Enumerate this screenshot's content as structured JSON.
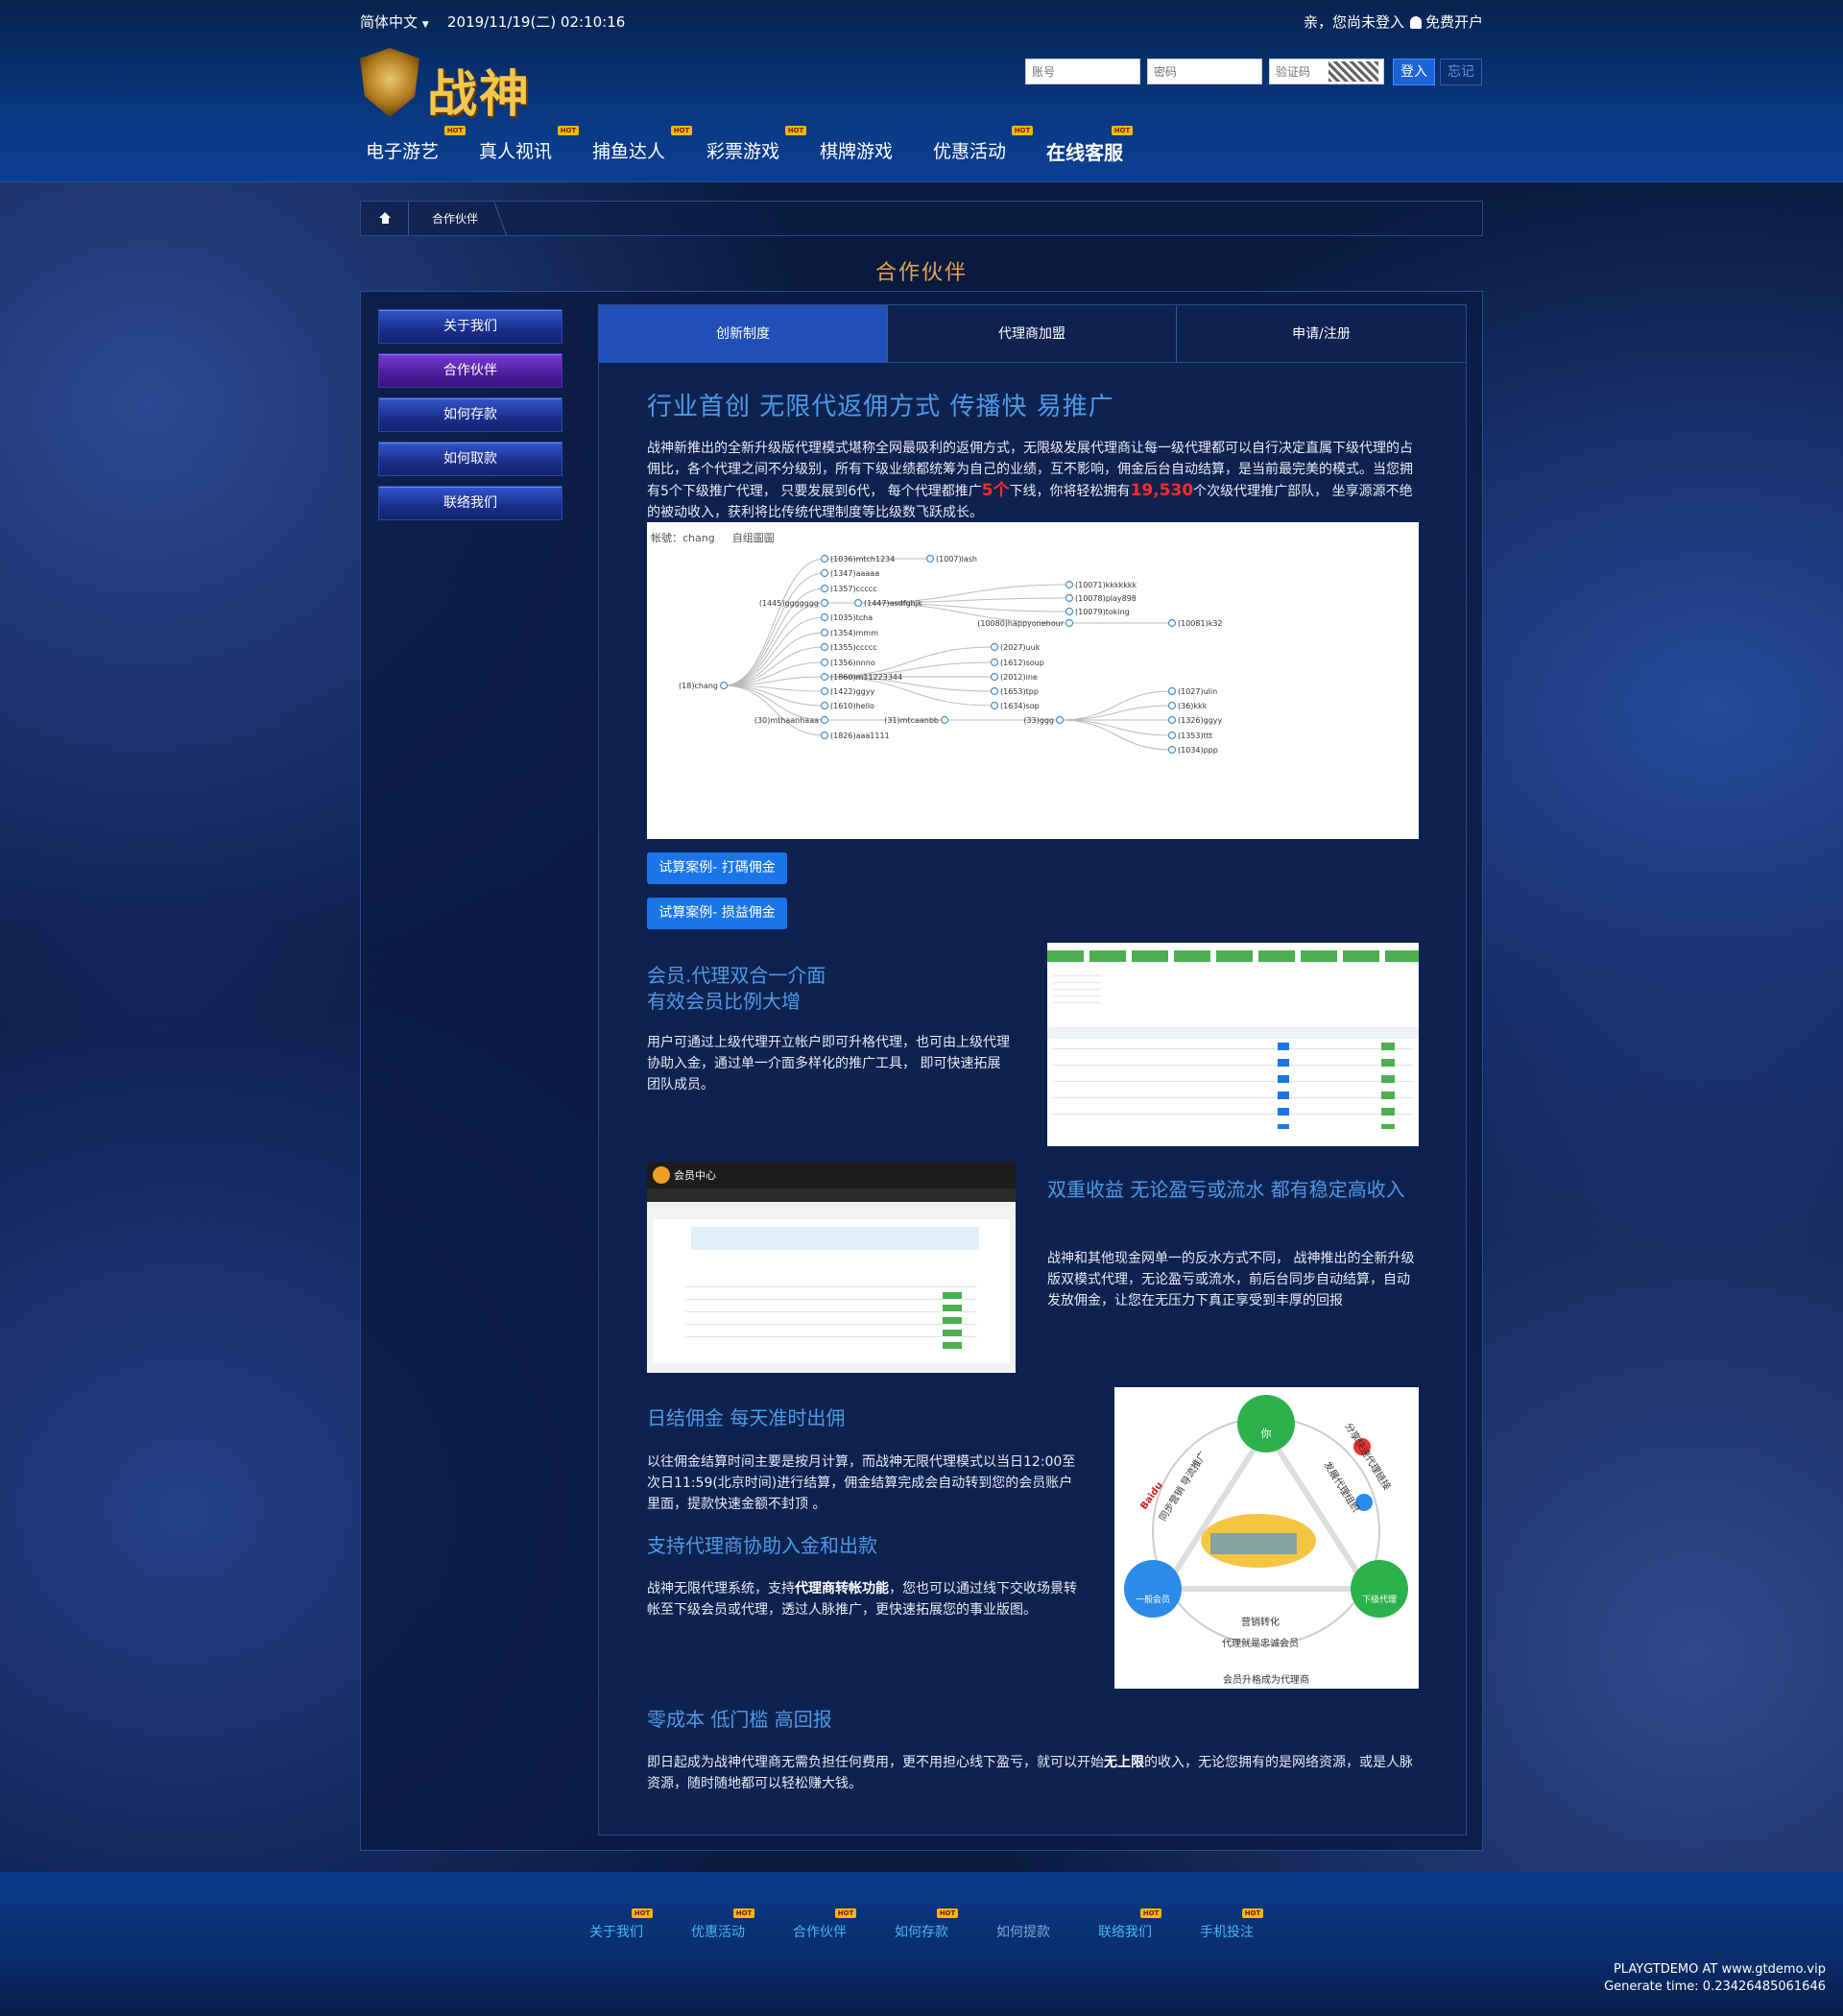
{
  "header": {
    "language": "简体中文",
    "datetime": "2019/11/19(二) 02:10:16",
    "login_tip": "亲，您尚未登入",
    "register": "免费开户",
    "logo_text": "战神",
    "account_placeholder": "账号",
    "password_placeholder": "密码",
    "captcha_placeholder": "验证码",
    "login_btn": "登入",
    "forget_btn": "忘记"
  },
  "nav": [
    {
      "label": "电子游艺",
      "hot": "HOT"
    },
    {
      "label": "真人视讯",
      "hot": "HOT"
    },
    {
      "label": "捕鱼达人",
      "hot": "HOT"
    },
    {
      "label": "彩票游戏",
      "hot": "HOT"
    },
    {
      "label": "棋牌游戏"
    },
    {
      "label": "优惠活动",
      "hot": "HOT"
    },
    {
      "label": "在线客服",
      "hot": "HOT"
    }
  ],
  "breadcrumb": {
    "current": "合作伙伴"
  },
  "page_title": "合作伙伴",
  "sidebar": [
    "关于我们",
    "合作伙伴",
    "如何存款",
    "如何取款",
    "联络我们"
  ],
  "tabs": [
    "创新制度",
    "代理商加盟",
    "申请/注册"
  ],
  "section1": {
    "title": "行业首创 无限代返佣方式 传播快 易推广",
    "p_a": "战神新推出的全新升级版代理模式堪称全网最吸利的返佣方式，无限级发展代理商让每一级代理都可以自行决定直属下级代理的占佣比，各个代理之间不分级别，所有下级业绩都统筹为自己的业绩，互不影响，佣金后台自动结算，是当前最完美的模式。当您拥有",
    "p_b": "5个下级推广代理， 只要发展到6代， 每个代理都推广",
    "highlight1": "5个",
    "p_c": "下线，你将轻松拥有",
    "highlight2": "19,530",
    "p_d": "个次级代理推广部队， 坐享源源不绝的被动收入，获利将比传统代理制度等比级数飞跃成长。"
  },
  "tree": {
    "account_label": "帐號：chang",
    "group_label": "自组圖圖",
    "nodes": [
      "(18)chang",
      "(1036)mtch1234",
      "(1007)lash",
      "(1347)aaaaa",
      "(1357)ccccc",
      "(1445)ggggggg",
      "(1447)asdfghjk",
      "(10071)kkkkkkk",
      "(10078)play898",
      "(10079)toking",
      "(10080)happyonehour",
      "(10081)k32",
      "(1035)tcha",
      "(1354)mmm",
      "(1355)ccccc",
      "(2027)uuk",
      "(1356)nnno",
      "(1612)soup",
      "(2012)ine",
      "(1860)m11223344",
      "(1653)tpp",
      "(1422)ggyy",
      "(1634)sop",
      "(1610)hello",
      "(1027)ulin",
      "(30)mthaanhaaa",
      "(31)mtcaanbb",
      "(33)ggg",
      "(36)kkk",
      "(1326)ggyy",
      "(1826)aaa1111",
      "(1353)ttt",
      "(1034)ppp"
    ]
  },
  "calc_btn1": "试算案例- 打碼佣金",
  "calc_btn2": "试算案例- 损益佣金",
  "section2": {
    "title_line1": "会员.代理双合一介面",
    "title_line2": "有效会员比例大增",
    "text": "用户可通过上级代理开立帐户即可升格代理，也可由上级代理协助入金，通过单一介面多样化的推广工具， 即可快速拓展团队成员。"
  },
  "section3": {
    "title": "双重收益 无论盈亏或流水 都有稳定高收入",
    "text": "战神和其他现金网单一的反水方式不同， 战神推出的全新升级版双模式代理，无论盈亏或流水，前后台同步自动结算，自动发放佣金，让您在无压力下真正享受到丰厚的回报"
  },
  "member_shot": {
    "title": "会员中心"
  },
  "section4": {
    "title": "日结佣金 每天准时出佣",
    "text": "以往佣金结算时间主要是按月计算，而战神无限代理模式以当日12:00至次日11:59(北京时间)进行结算，佣金结算完成会自动转到您的会员账户里面，提款快速金额不封顶 。"
  },
  "section5": {
    "title": "支持代理商协助入金和出款",
    "text_a": "战神无限代理系统，支持",
    "bold": "代理商转帐功能",
    "text_b": "，您也可以通过线下交收场景转帐至下级会员或代理，透过人脉推广，更快速拓展您的事业版图。"
  },
  "circle": {
    "you": "你",
    "member": "一般会员",
    "agent": "下级代理",
    "left_label": "同步营销 导流推广",
    "right_label1": "分享快速代理链接",
    "right_label2": "发展代理组织",
    "bottom1": "营销转化",
    "bottom2": "代理就是忠诚会员",
    "bottom3": "会员升格成为代理商",
    "brand": "Baidu"
  },
  "section6": {
    "title": "零成本 低门槛 高回报",
    "text_a": "即日起成为战神代理商无需负担任何费用，更不用担心线下盈亏，就可以开始",
    "bold": "无上限",
    "text_b": "的收入，无论您拥有的是网络资源，或是人脉资源，随时随地都可以轻松赚大钱。"
  },
  "footer": {
    "links": [
      {
        "label": "关于我们",
        "hot": "HOT"
      },
      {
        "label": "优惠活动",
        "hot": "HOT"
      },
      {
        "label": "合作伙伴",
        "hot": "HOT"
      },
      {
        "label": "如何存款",
        "hot": "HOT"
      },
      {
        "label": "如何提款"
      },
      {
        "label": "联络我们",
        "hot": "HOT"
      },
      {
        "label": "手机投注",
        "hot": "HOT"
      }
    ],
    "credit1": "PLAYGTDEMO AT www.gtdemo.vip",
    "credit2": "Generate time: 0.23426485061646"
  },
  "colors": {
    "accent": "#2050b8",
    "title": "#4d9ae6",
    "page_title": "#e2a652",
    "hot": "#f6b800",
    "highlight": "#ff2a2a"
  }
}
